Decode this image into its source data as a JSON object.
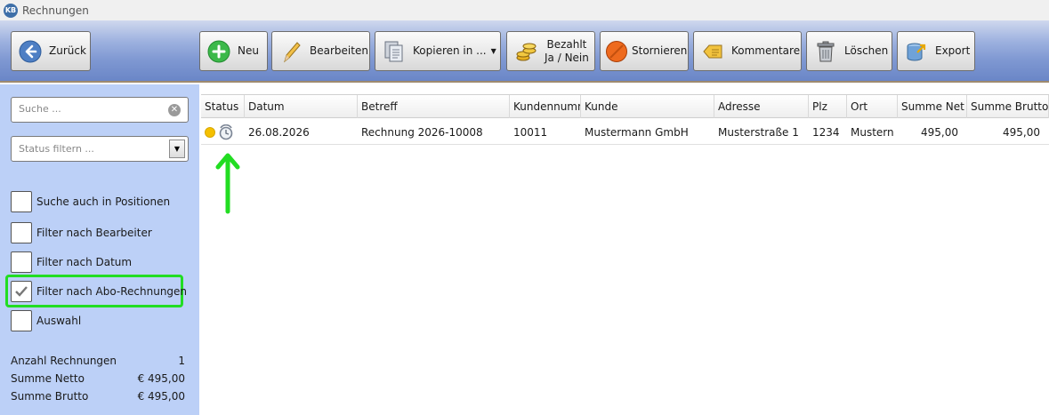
{
  "window": {
    "title": "Rechnungen",
    "logo_text": "KB"
  },
  "toolbar": {
    "back_label": "Zurück",
    "new_label": "Neu",
    "edit_label": "Bearbeiten",
    "copy_label": "Kopieren in ...",
    "paid_label_line1": "Bezahlt",
    "paid_label_line2": "Ja / Nein",
    "cancel_label": "Stornieren",
    "comment_label": "Kommentare",
    "delete_label": "Löschen",
    "export_label": "Export"
  },
  "sidebar": {
    "search_placeholder": "Suche ...",
    "status_placeholder": "Status filtern ...",
    "checkboxes": [
      {
        "label": "Suche auch in Positionen",
        "checked": false
      },
      {
        "label": "Filter nach Bearbeiter",
        "checked": false
      },
      {
        "label": "Filter nach Datum",
        "checked": false
      },
      {
        "label": "Filter nach Abo-Rechnungen",
        "checked": true
      },
      {
        "label": "Auswahl",
        "checked": false
      }
    ],
    "summary": {
      "count_label": "Anzahl Rechnungen",
      "count_value": "1",
      "net_label": "Summe Netto",
      "net_value": "€ 495,00",
      "gross_label": "Summe Brutto",
      "gross_value": "€ 495,00"
    }
  },
  "grid": {
    "columns": [
      "Status",
      "Datum",
      "Betreff",
      "Kundennummer",
      "Kunde",
      "Adresse",
      "Plz",
      "Ort",
      "Summe Net",
      "Summe Brutto"
    ],
    "rows": [
      {
        "status": "open",
        "datum": "26.08.2026",
        "betreff": "Rechnung 2026-10008",
        "kundennummer": "10011",
        "kunde": "Mustermann GmbH",
        "adresse": "Musterstraße 1",
        "plz": "1234",
        "ort": "Mustern",
        "summe_netto": "495,00",
        "summe_brutto": "495,00"
      }
    ]
  },
  "colors": {
    "highlight_green": "#22dd22",
    "status_yellow": "#f5c000",
    "sidebar_bg": "#bcd0f7",
    "toolbar_blue": "#7f98d2"
  },
  "icons": {
    "back": "arrow-left-circle-icon",
    "new": "plus-circle-icon",
    "edit": "pencil-icon",
    "copy": "documents-icon",
    "paid": "coins-icon",
    "cancel": "no-entry-icon",
    "comment": "comment-icon",
    "delete": "trash-icon",
    "export": "export-icon",
    "status": "status-dot-icon",
    "abo": "recurring-clock-icon",
    "annotation": "arrow-up-icon"
  }
}
